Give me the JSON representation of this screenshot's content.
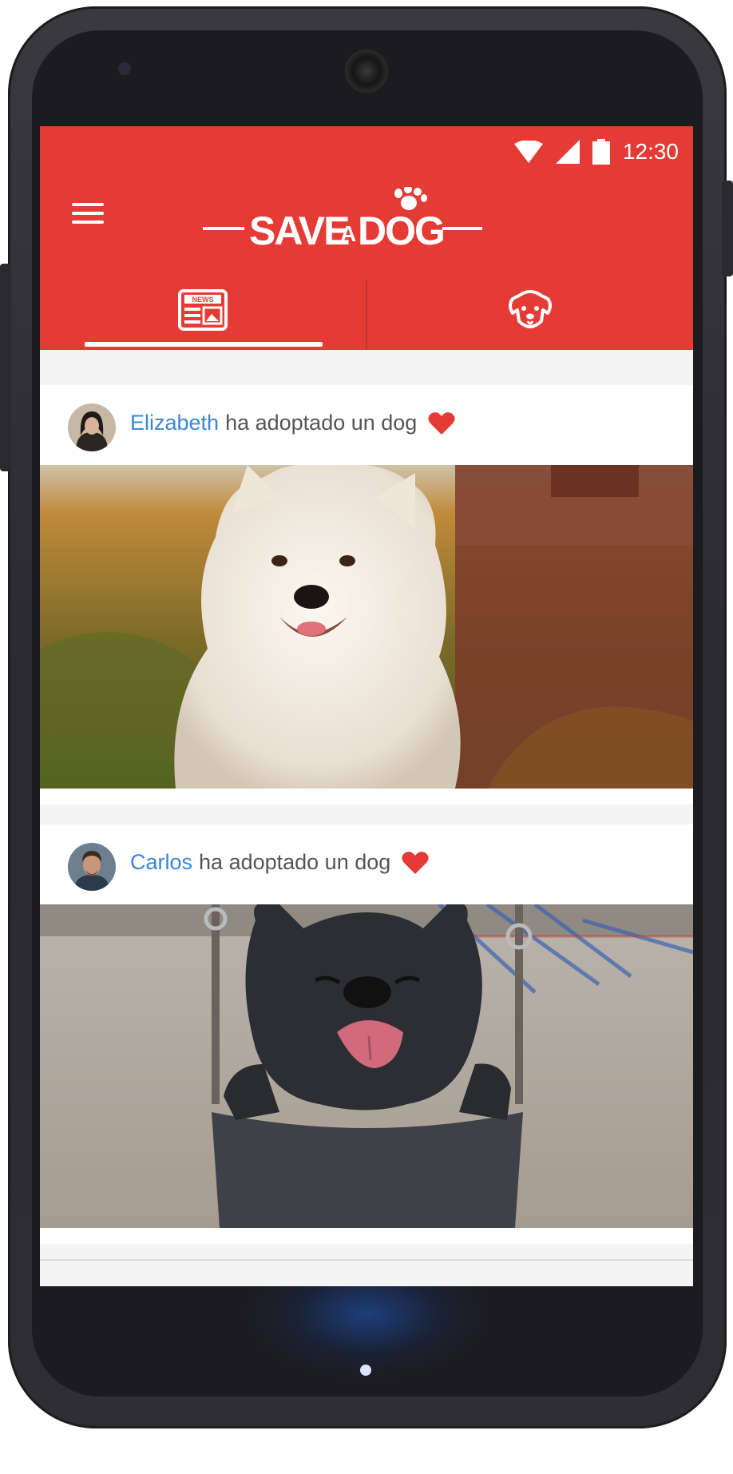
{
  "status_bar": {
    "time": "12:30",
    "icons": [
      "wifi-icon",
      "signal-icon",
      "battery-icon"
    ]
  },
  "app": {
    "brand_color": "#e53b35",
    "logo_text": "SAVE A DOG",
    "menu_icon": "hamburger-menu-icon"
  },
  "tabs": [
    {
      "icon": "news-icon",
      "icon_text": "NEWS",
      "selected": true
    },
    {
      "icon": "dog-face-icon",
      "selected": false
    }
  ],
  "feed": [
    {
      "user": "Elizabeth",
      "action": "ha adoptado un dog",
      "icon": "heart-icon",
      "photo": "white-terrier-in-grass"
    },
    {
      "user": "Carlos",
      "action": "ha adoptado un dog",
      "icon": "heart-icon",
      "photo": "french-bulldog-in-swing"
    }
  ],
  "colors": {
    "username": "#3b86d6",
    "heart": "#e53b35",
    "text": "#555555"
  }
}
